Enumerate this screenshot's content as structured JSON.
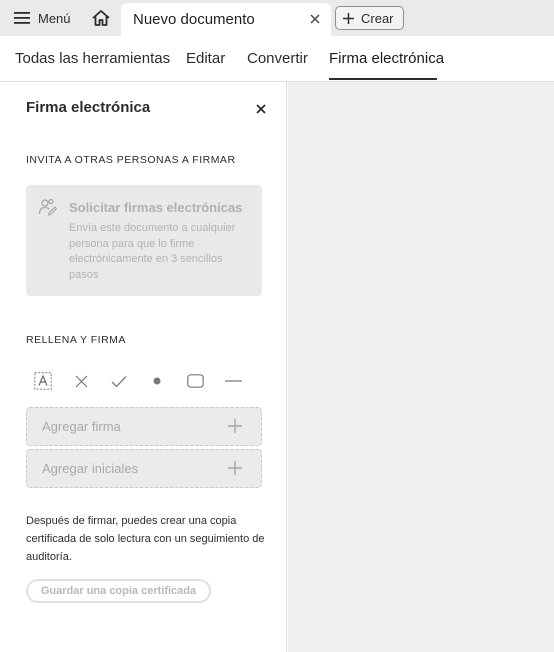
{
  "titlebar": {
    "menu_label": "Menú",
    "doc_tab_title": "Nuevo documento",
    "create_label": "Crear"
  },
  "toolnav": {
    "tabs": [
      {
        "label": "Todas las herramientas",
        "active": false
      },
      {
        "label": "Editar",
        "active": false
      },
      {
        "label": "Convertir",
        "active": false
      },
      {
        "label": "Firma electrónica",
        "active": true
      }
    ]
  },
  "panel": {
    "title": "Firma electrónica",
    "invite_section": "INVITA A OTRAS PERSONAS A FIRMAR",
    "request_card": {
      "title": "Solicitar firmas electrónicas",
      "description": "Envía este documento a cualquier persona para que lo firme electrónicamente en 3 sencillos pasos"
    },
    "fill_section": "RELLENA Y FIRMA",
    "tools": [
      "text-field-icon",
      "cross-mark-icon",
      "check-mark-icon",
      "dot-icon",
      "rounded-box-icon",
      "line-icon"
    ],
    "add_signature": "Agregar firma",
    "add_initials": "Agregar iniciales",
    "note": "Después de firmar, puedes crear una copia certificada de solo lectura con un seguimiento de auditoría.",
    "save_certified": "Guardar una copia certificada"
  },
  "colors": {
    "titlebar_bg": "#eaeaea",
    "canvas_bg": "#f0f0f0",
    "card_bg": "#e9e9e9",
    "disabled_text": "#b0b0b0"
  }
}
